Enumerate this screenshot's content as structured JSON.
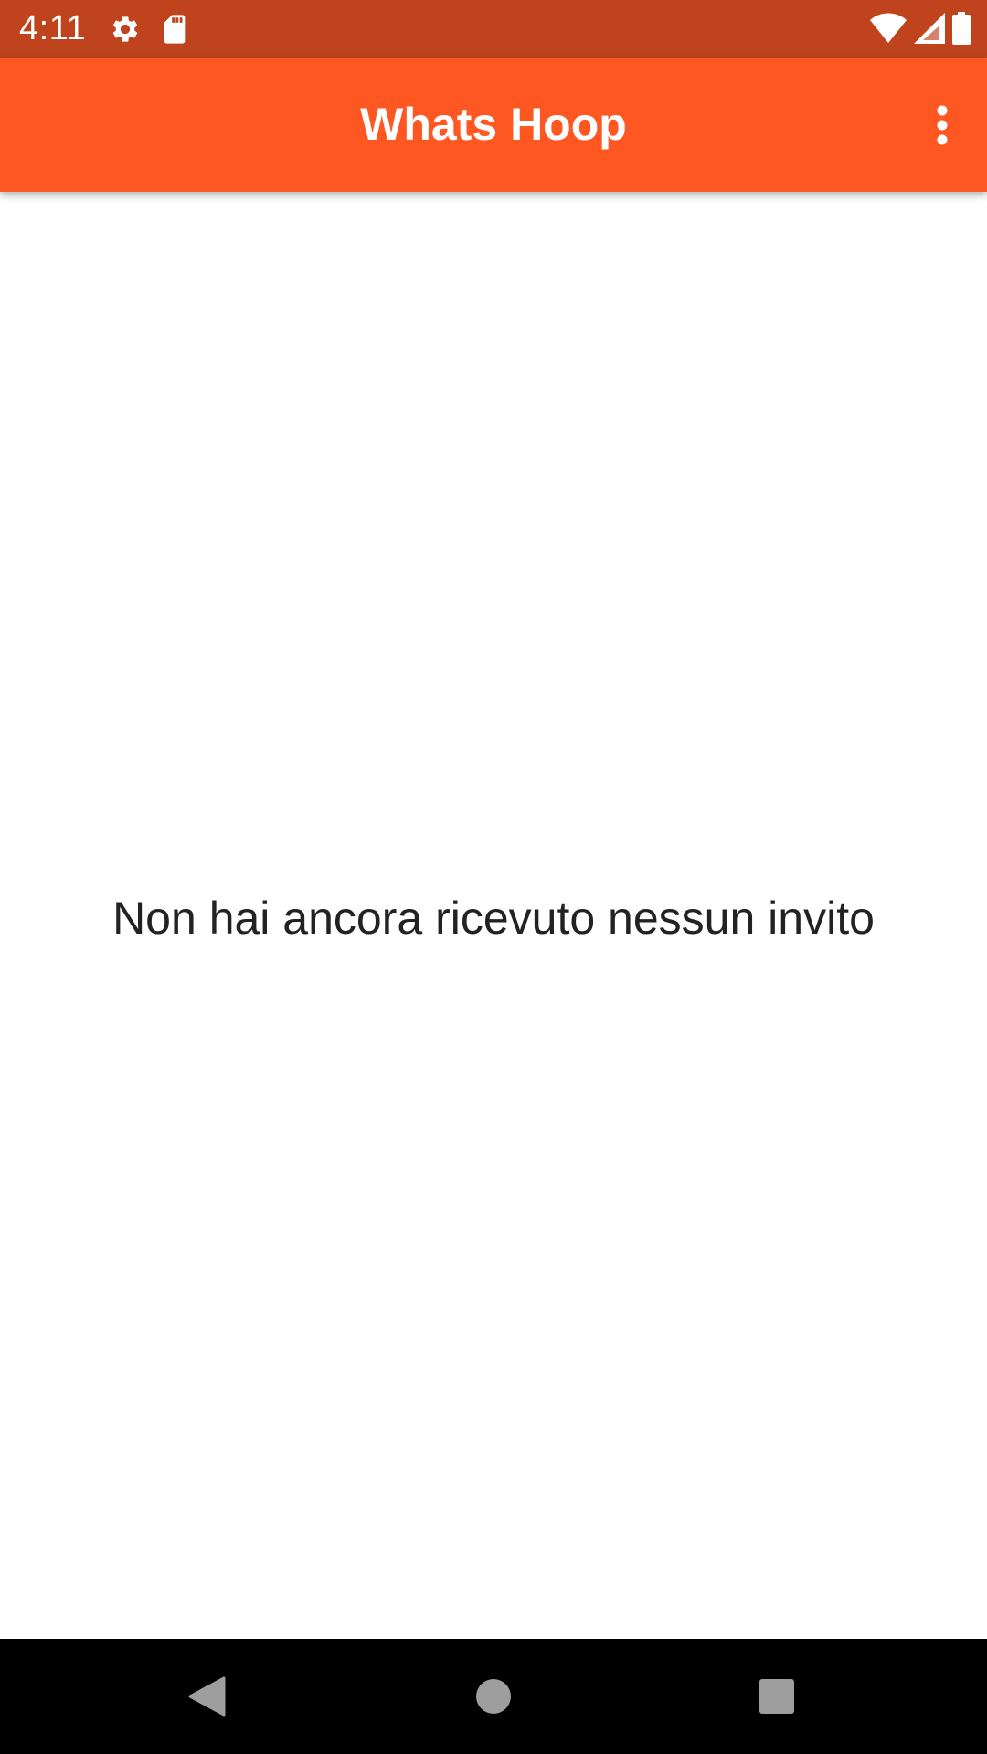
{
  "status_bar": {
    "time": "4:11",
    "background": "#bf431d",
    "icons_left": [
      "settings-icon",
      "sd-card-icon"
    ],
    "icons_right": [
      "wifi-icon",
      "cell-signal-icon",
      "battery-icon"
    ]
  },
  "app_bar": {
    "title": "Whats Hoop",
    "background": "#ff5722",
    "overflow_icon": "more-vert-icon"
  },
  "main": {
    "empty_message": "Non hai ancora ricevuto nessun invito"
  },
  "nav_bar": {
    "buttons": [
      "back-icon",
      "home-icon",
      "recents-icon"
    ]
  }
}
